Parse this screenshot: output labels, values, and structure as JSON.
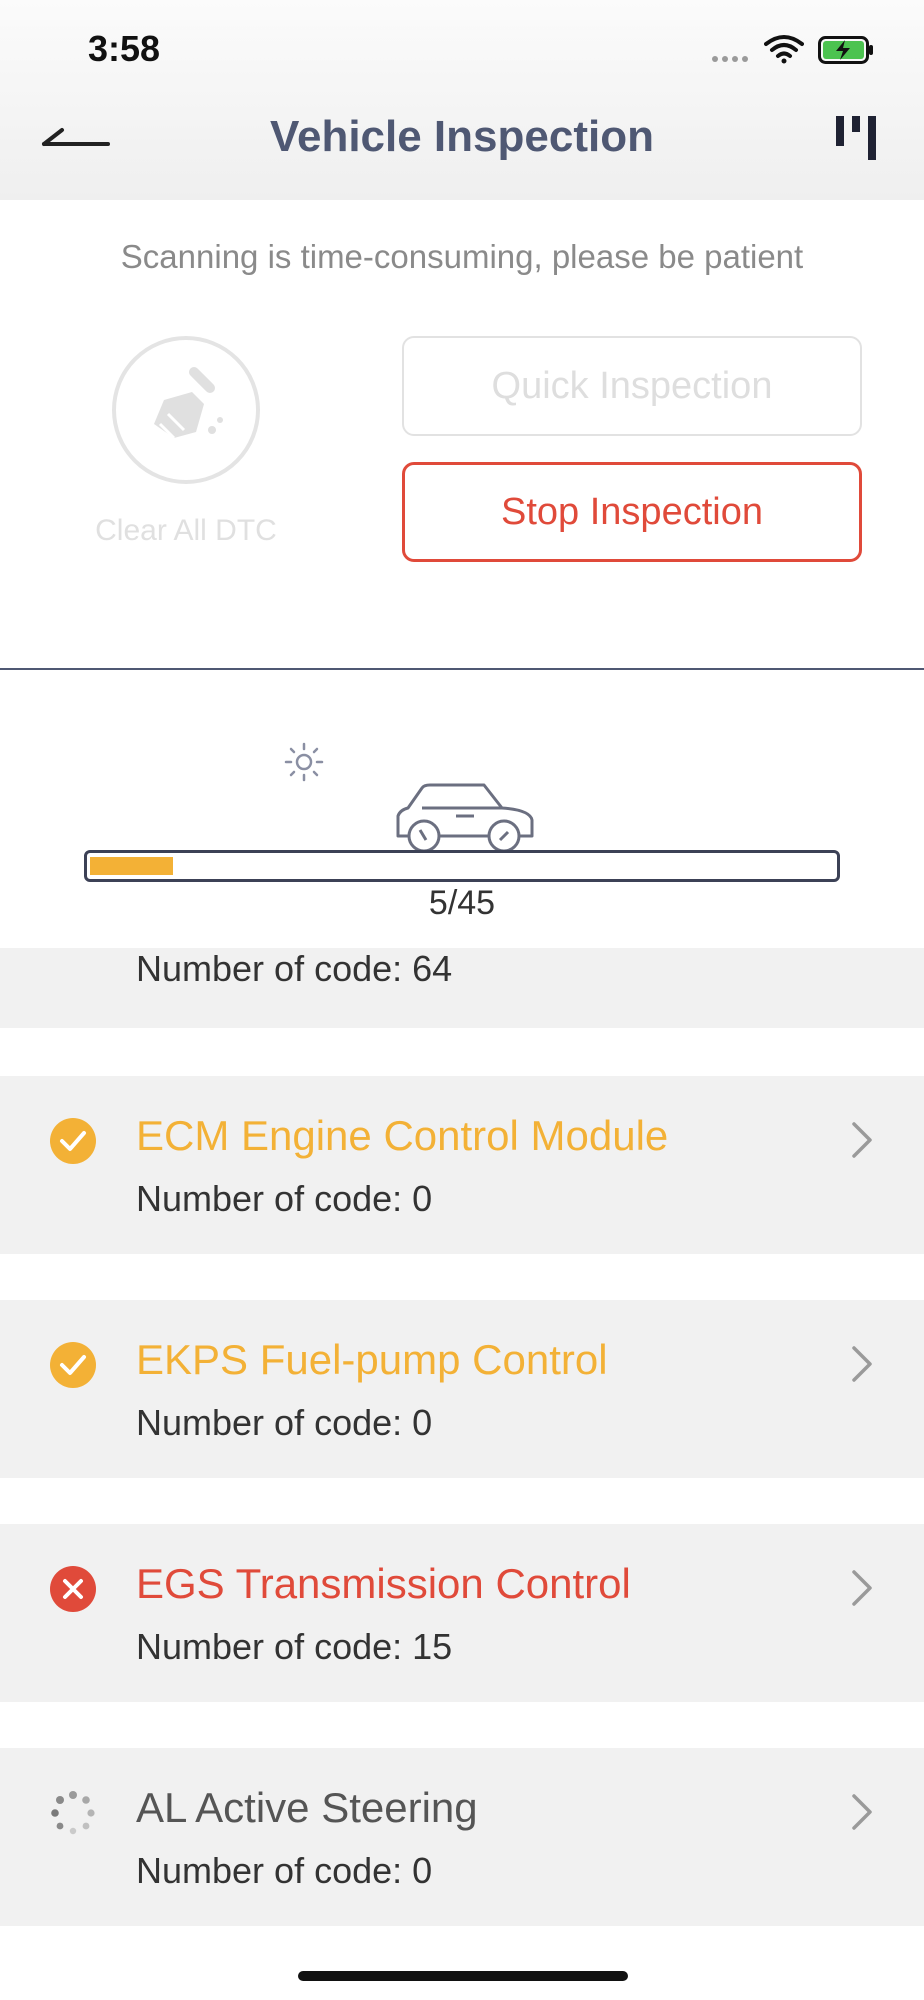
{
  "status_bar": {
    "time": "3:58"
  },
  "header": {
    "title": "Vehicle Inspection",
    "background": "#f3f3f3",
    "title_color": "#4f5873"
  },
  "controls": {
    "hint": "Scanning is time-consuming, please be patient",
    "clear_dtc_label": "Clear All DTC",
    "quick_button": "Quick Inspection",
    "stop_button": "Stop Inspection",
    "stop_color": "#e04a3a"
  },
  "progress": {
    "label": "5/45",
    "current": 5,
    "total": 45,
    "fill_color": "#f3b136"
  },
  "modules": {
    "partial_code": "Number of code: 64",
    "items": [
      {
        "name": "ECM Engine Control Module",
        "code": "Number of code: 0",
        "status": "ok",
        "icon": "check-circle-icon",
        "color": "#f3b136"
      },
      {
        "name": "EKPS Fuel-pump Control",
        "code": "Number of code: 0",
        "status": "ok",
        "icon": "check-circle-icon",
        "color": "#f3b136"
      },
      {
        "name": "EGS Transmission Control",
        "code": "Number of code: 15",
        "status": "error",
        "icon": "error-circle-icon",
        "color": "#e04a3a"
      },
      {
        "name": "AL Active Steering",
        "code": "Number of code: 0",
        "status": "scanning",
        "icon": "loading-spinner-icon",
        "color": "#555555"
      }
    ]
  }
}
